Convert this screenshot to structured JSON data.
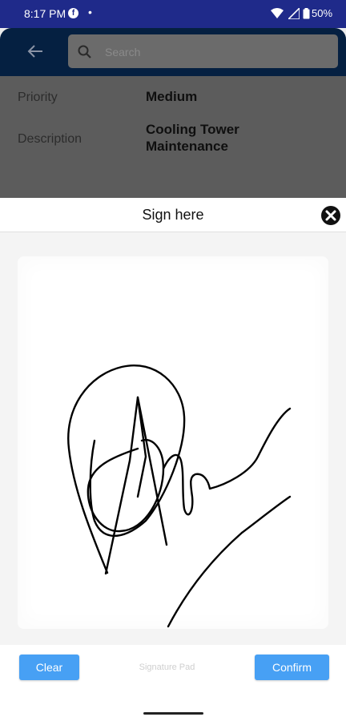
{
  "status_bar": {
    "time": "8:17 PM",
    "notification_dot": "•",
    "battery": "50%",
    "background_color": "#1f2a8a"
  },
  "app_bar": {
    "search_placeholder": "Search",
    "background_color": "#052041"
  },
  "details": {
    "priority_label": "Priority",
    "priority_value": "Medium",
    "description_label": "Description",
    "description_value": "Cooling Tower Maintenance"
  },
  "signature_sheet": {
    "title": "Sign here",
    "clear_label": "Clear",
    "pad_caption": "Signature Pad",
    "confirm_label": "Confirm",
    "button_color": "#47a0f4"
  }
}
